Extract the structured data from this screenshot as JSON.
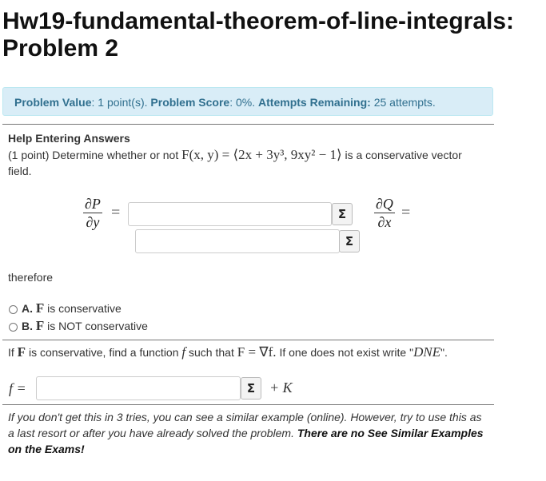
{
  "title": {
    "line1": "Hw19-fundamental-theorem-of-line-integrals:",
    "line2": "Problem 2"
  },
  "info": {
    "value_label": "Problem Value",
    "value_text": ": 1 point(s).",
    "score_label": "Problem Score",
    "score_text": ": 0%.",
    "attempts_label": "Attempts Remaining:",
    "attempts_text": "25 attempts."
  },
  "help_link": "Help Entering Answers",
  "problem": {
    "prefix": "(1 point) Determine whether or not",
    "field_expr": "F(x, y) = ⟨2x + 3y³, 9xy² − 1⟩",
    "suffix": "is a conservative vector",
    "line2": "field."
  },
  "partials": {
    "dp_num": "∂P",
    "dp_den": "∂y",
    "dq_num": "∂Q",
    "dq_den": "∂x",
    "equals": "="
  },
  "sigma_symbol": "Σ",
  "therefore": "therefore",
  "options": [
    {
      "letter": "A.",
      "symbol": "F",
      "text": "is conservative"
    },
    {
      "letter": "B.",
      "symbol": "F",
      "text": "is NOT conservative"
    }
  ],
  "find": {
    "prefix": "If",
    "symbol": "F",
    "middle": "is conservative, find a function",
    "f": "f",
    "such": "such that",
    "eq": "F = ∇f.",
    "rest": "If one does not exist write \"",
    "dne": "DNE",
    "end": "\"."
  },
  "answer": {
    "f_label": "f =",
    "plus_k": "+ K"
  },
  "note": {
    "italic": "If you don't get this in 3 tries, you can see a similar example (online). However, try to use this as a last resort or after you have already solved the problem.",
    "bold": "There are no See Similar Examples on the Exams!"
  },
  "colors": {
    "info_bg": "#d9edf7",
    "info_text": "#31708f"
  }
}
